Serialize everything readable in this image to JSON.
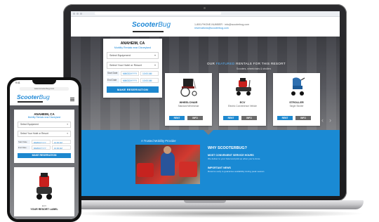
{
  "colors": {
    "brand_blue": "#1d88cf",
    "band_blue": "#1a8ad4",
    "dark_button": "#6a6a6a",
    "bezel": "#1b1b1d"
  },
  "site": {
    "logo_main": "Scooter",
    "logo_sub": "Bug",
    "header_contact_line1": "1-800-PHONE-NUMBER  ·  info@scooterbug.com",
    "header_contact_link": "reservations@scooterbug.com"
  },
  "reservation": {
    "city": "ANAHEIM, CA",
    "subtitle": "Mobility Rentals near Disneyland",
    "equipment_placeholder": "Select Equipment",
    "hotel_placeholder": "Select Your Hotel or Resort",
    "start_label": "Start Date",
    "start_value": "MM/DD/YYYY",
    "end_label": "End Date",
    "end_value": "MM/DD/YYYY",
    "time_value": "10:00 AM",
    "cta_label": "MAKE RESERVATION"
  },
  "featured": {
    "title_pre": "OUR ",
    "title_highlight": "FEATURED",
    "title_post": " RENTALS FOR THIS RESORT",
    "subtitle": "Scooters, wheelchairs & strollers"
  },
  "products": [
    {
      "name": "WHEELCHAIR",
      "price": "Standard Wheelchair",
      "rent_label": "RENT",
      "info_label": "INFO",
      "icon": "wheelchair-icon"
    },
    {
      "name": "ECV",
      "price": "Electric Convenience Vehicle",
      "rent_label": "RENT",
      "info_label": "INFO",
      "icon": "scooter-icon"
    },
    {
      "name": "STROLLER",
      "price": "Single Stroller",
      "rent_label": "RENT",
      "info_label": "INFO",
      "icon": "stroller-icon"
    }
  ],
  "why": {
    "caption": "A Trusted Mobility Provider",
    "title": "WHY SCOOTERBUG?",
    "h1": "MOST CONVENIENT SERVICE HOURS",
    "t1": "We deliver to your hotel and pick up when you're done.",
    "h2": "IMPORTANT NEWS",
    "t2": "Reserve early to guarantee availability during peak season."
  },
  "phone": {
    "status_time": "9:41",
    "url": "www.scooterbug.com",
    "city": "ANAHEIM, CA",
    "subtitle": "Mobility Rentals near Disneyland",
    "equipment_placeholder": "Select Equipment",
    "hotel_placeholder": "Select Your Hotel or Resort",
    "cta_label": "MAKE RESERVATION",
    "product_price": "ECV",
    "product_name": "YOUR RESORT LABEL"
  }
}
